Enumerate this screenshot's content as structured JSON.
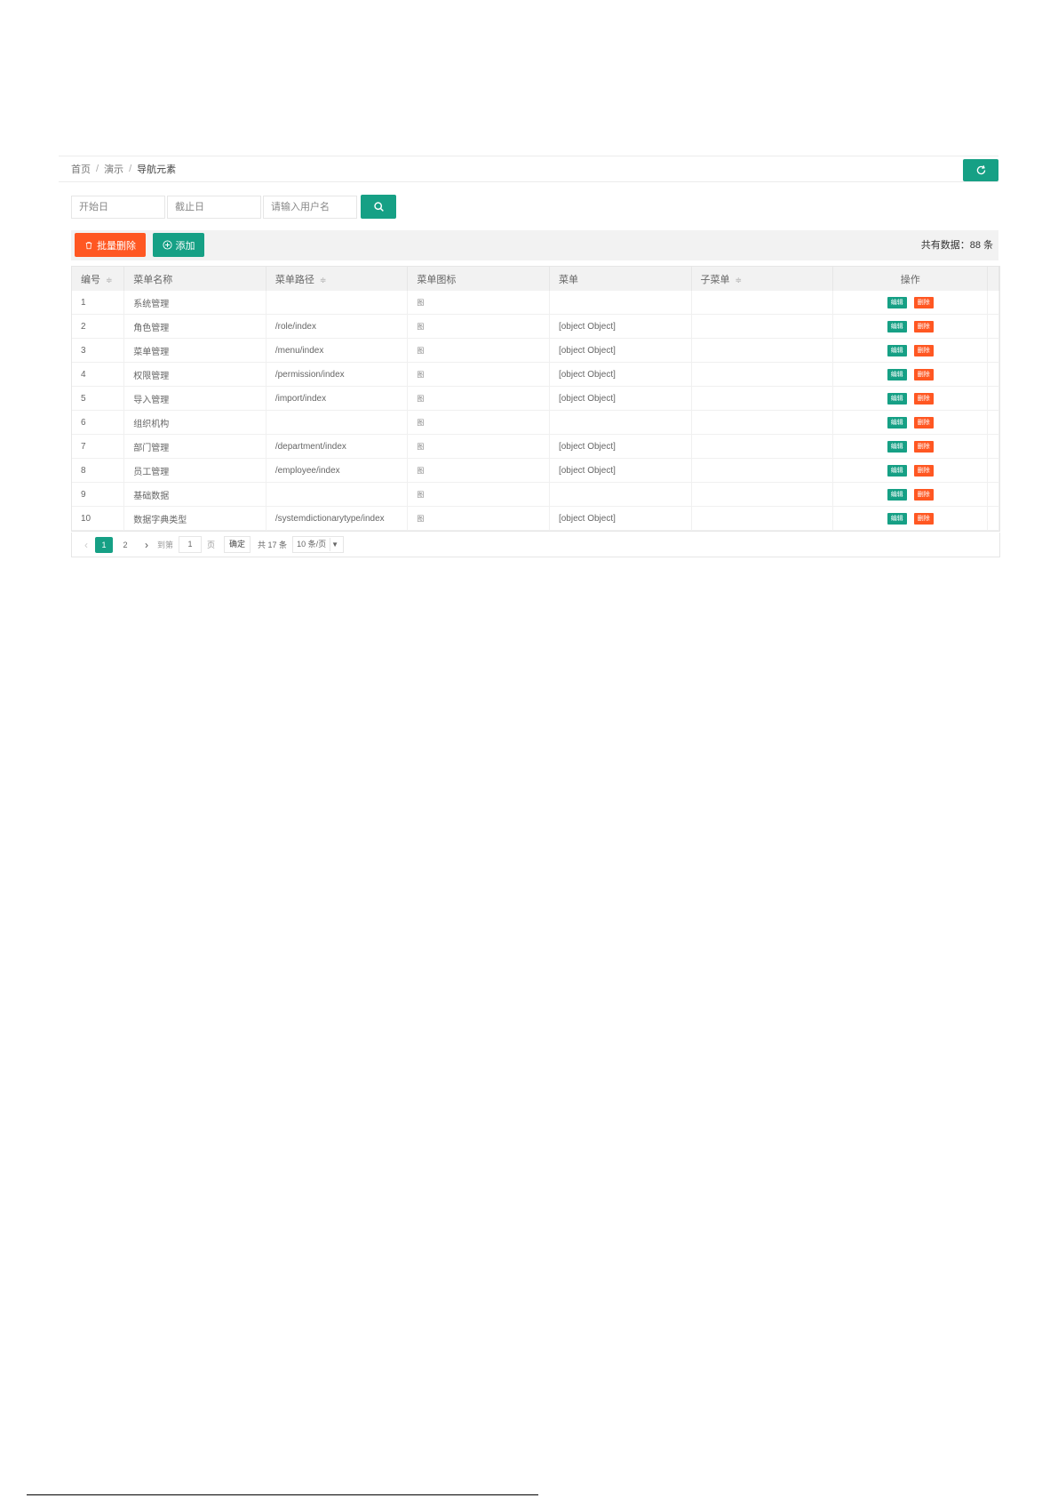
{
  "breadcrumb": {
    "items": [
      "首页",
      "演示",
      "导航元素"
    ]
  },
  "search": {
    "start_placeholder": "开始日",
    "end_placeholder": "截止日",
    "username_placeholder": "请输入用户名"
  },
  "toolbar": {
    "batch_delete_label": "批量删除",
    "add_label": "添加",
    "total_label": "共有数据：88 条"
  },
  "table": {
    "columns": [
      {
        "label": "编号",
        "sortable": true
      },
      {
        "label": "菜单名称",
        "sortable": false
      },
      {
        "label": "菜单路径",
        "sortable": true
      },
      {
        "label": "菜单图标",
        "sortable": false
      },
      {
        "label": "菜单",
        "sortable": false
      },
      {
        "label": "子菜单",
        "sortable": true
      },
      {
        "label": "操作",
        "sortable": false
      }
    ],
    "edit_label": "编辑",
    "delete_label": "删除",
    "rows": [
      {
        "id": "1",
        "name": "系统管理",
        "path": "",
        "icon": "图",
        "menu": ""
      },
      {
        "id": "2",
        "name": "角色管理",
        "path": "/role/index",
        "icon": "图",
        "menu": "[object Object]"
      },
      {
        "id": "3",
        "name": "菜单管理",
        "path": "/menu/index",
        "icon": "图",
        "menu": "[object Object]"
      },
      {
        "id": "4",
        "name": "权限管理",
        "path": "/permission/index",
        "icon": "图",
        "menu": "[object Object]"
      },
      {
        "id": "5",
        "name": "导入管理",
        "path": "/import/index",
        "icon": "图",
        "menu": "[object Object]"
      },
      {
        "id": "6",
        "name": "组织机构",
        "path": "",
        "icon": "图",
        "menu": ""
      },
      {
        "id": "7",
        "name": "部门管理",
        "path": "/department/index",
        "icon": "图",
        "menu": "[object Object]"
      },
      {
        "id": "8",
        "name": "员工管理",
        "path": "/employee/index",
        "icon": "图",
        "menu": "[object Object]"
      },
      {
        "id": "9",
        "name": "基础数据",
        "path": "",
        "icon": "图",
        "menu": ""
      },
      {
        "id": "10",
        "name": "数据字典类型",
        "path": "/systemdictionarytype/index",
        "icon": "图",
        "menu": "[object Object]"
      }
    ]
  },
  "pagination": {
    "prev": "‹",
    "pages": [
      "1",
      "2"
    ],
    "current": "1",
    "next": "›",
    "goto_label": "到第",
    "goto_value": "1",
    "page_unit": "页",
    "confirm_label": "确定",
    "total_label": "共 17 条",
    "page_size_label": "10 条/页"
  },
  "colors": {
    "primary": "#16a085",
    "danger": "#ff5722"
  },
  "icons": [
    "refresh-icon",
    "search-icon",
    "trash-icon",
    "plus-circle-icon",
    "sort-icon",
    "chevron-down-icon"
  ]
}
